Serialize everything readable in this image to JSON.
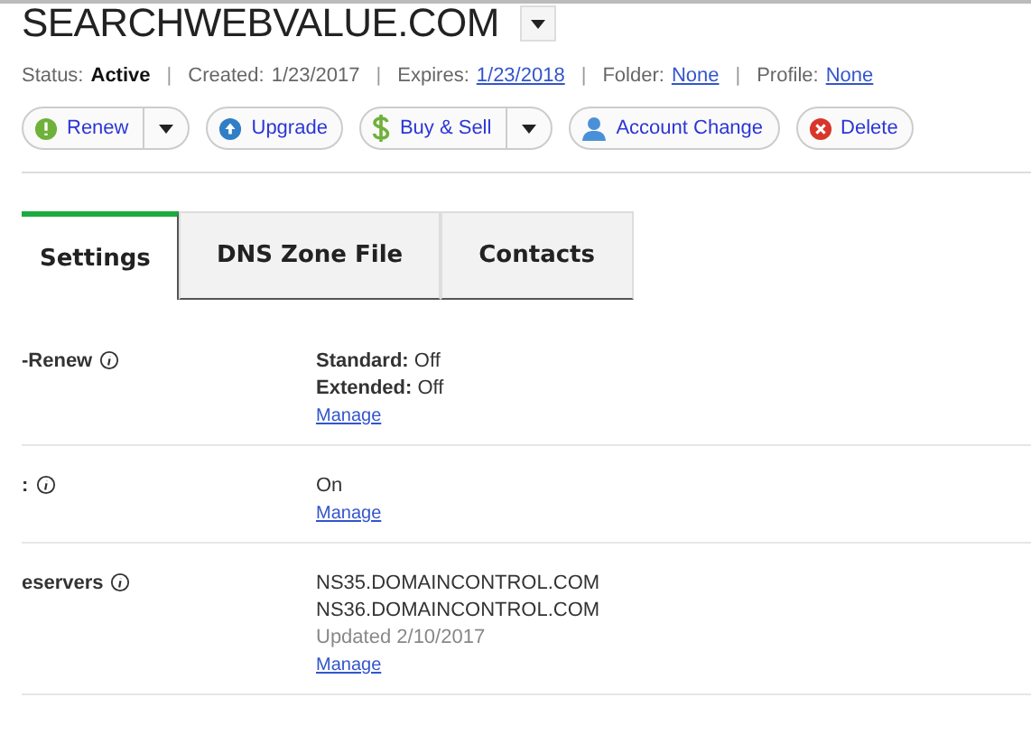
{
  "domain": {
    "title": "SEARCHWEBVALUE.COM"
  },
  "status_line": [
    {
      "label": "Status:",
      "value": "Active",
      "kind": "bold"
    },
    {
      "separator": "|",
      "label": "Created:",
      "value": "1/23/2017",
      "kind": "plain"
    },
    {
      "separator": "|",
      "label": "Expires:",
      "value": "1/23/2018",
      "kind": "link"
    },
    {
      "separator": "|",
      "label": "Folder:",
      "value": "None",
      "kind": "link"
    },
    {
      "separator": "|",
      "label": "Profile:",
      "value": "None",
      "kind": "link"
    }
  ],
  "actions": [
    {
      "label": "Renew",
      "kind": "renew",
      "has_menu": true
    },
    {
      "label": "Upgrade",
      "kind": "upgrade",
      "has_menu": false
    },
    {
      "label": "Buy & Sell",
      "kind": "buy",
      "has_menu": true
    },
    {
      "label": "Account Change",
      "kind": "account",
      "has_menu": false
    },
    {
      "label": "Delete",
      "kind": "delete",
      "has_menu": false
    }
  ],
  "tabs": [
    {
      "label": "Settings",
      "selected": true
    },
    {
      "label": "DNS Zone File",
      "selected": false
    },
    {
      "label": "Contacts",
      "selected": false
    }
  ],
  "settings": [
    {
      "label": "-Renew",
      "lines": [
        {
          "kind": "pair",
          "key": "Standard:",
          "text": "Off"
        },
        {
          "kind": "pair",
          "key": "Extended:",
          "text": "Off"
        },
        {
          "kind": "link",
          "text": "Manage"
        }
      ]
    },
    {
      "label": ":",
      "lines": [
        {
          "kind": "plain",
          "text": "On"
        },
        {
          "kind": "link",
          "text": "Manage"
        }
      ]
    },
    {
      "label": "eservers",
      "lines": [
        {
          "kind": "plain",
          "text": "NS35.DOMAINCONTROL.COM"
        },
        {
          "kind": "plain",
          "text": "NS36.DOMAINCONTROL.COM"
        },
        {
          "kind": "muted",
          "text": "Updated 2/10/2017"
        },
        {
          "kind": "link",
          "text": "Manage"
        }
      ]
    }
  ]
}
